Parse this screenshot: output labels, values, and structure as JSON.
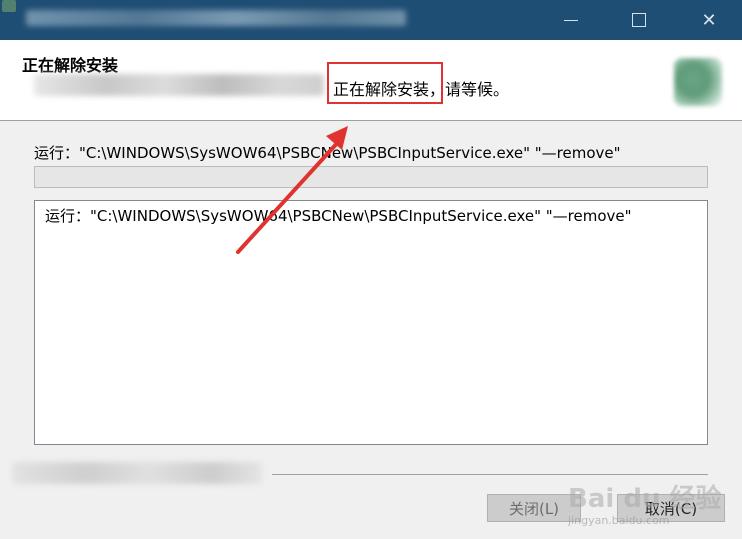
{
  "header": {
    "title": "正在解除安装",
    "subtitle": "正在解除安装，请等候。"
  },
  "status": {
    "text": "运行：\"C:\\WINDOWS\\SysWOW64\\PSBCNew\\PSBCInputService.exe\" \"—remove\""
  },
  "progress": {
    "value": 0
  },
  "log": {
    "items": [
      "运行：\"C:\\WINDOWS\\SysWOW64\\PSBCNew\\PSBCInputService.exe\" \"—remove\""
    ]
  },
  "buttons": {
    "close_label": "关闭(L)",
    "cancel_label": "取消(C)"
  },
  "window": {
    "minimize_symbol": "",
    "close_symbol": "✕"
  },
  "watermark": {
    "brand": "Bai du 经验",
    "url": "jingyan.baidu.com"
  },
  "colors": {
    "titlebar": "#1f4e74",
    "highlight": "#e0322f",
    "arrow": "#e0322f"
  }
}
